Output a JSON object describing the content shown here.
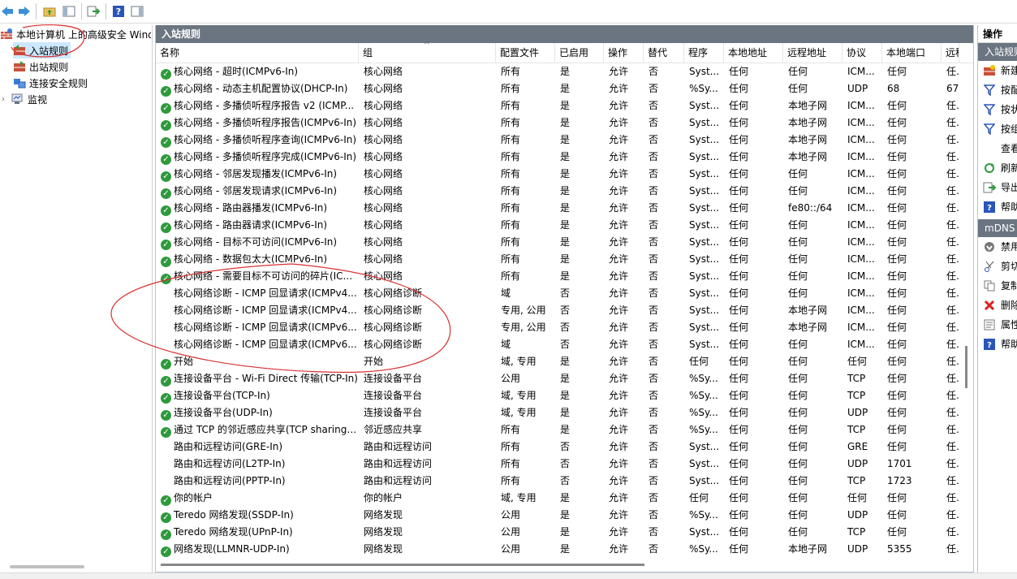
{
  "toolbar": {
    "icons": [
      "back-arrow-icon",
      "forward-arrow-icon",
      "folder-up-icon",
      "show-hide-console-tree-icon",
      "export-list-icon",
      "help-icon",
      "show-hide-action-pane-icon"
    ]
  },
  "tree": {
    "root": "本地计算机 上的高级安全 Windows Defender 防火墙",
    "items": [
      "入站规则",
      "出站规则",
      "连接安全规则",
      "监视"
    ]
  },
  "panel": {
    "title": "入站规则",
    "columns": [
      "名称",
      "组",
      "配置文件",
      "已启用",
      "操作",
      "替代",
      "程序",
      "本地地址",
      "远程地址",
      "协议",
      "本地端口",
      "远程"
    ],
    "rows": [
      {
        "enabled_icon": true,
        "name": "核心网络 - 超时(ICMPv6-In)",
        "group": "核心网络",
        "profile": "所有",
        "enabled": "是",
        "action": "允许",
        "override": "否",
        "program": "Syst...",
        "local_addr": "任何",
        "remote_addr": "任何",
        "protocol": "ICM...",
        "local_port": "任何",
        "remote": "任何"
      },
      {
        "enabled_icon": true,
        "name": "核心网络 - 动态主机配置协议(DHCP-In)",
        "group": "核心网络",
        "profile": "所有",
        "enabled": "是",
        "action": "允许",
        "override": "否",
        "program": "%Sy...",
        "local_addr": "任何",
        "remote_addr": "任何",
        "protocol": "UDP",
        "local_port": "68",
        "remote": "67"
      },
      {
        "enabled_icon": true,
        "name": "核心网络 - 多播侦听程序报告 v2 (ICMP...",
        "group": "核心网络",
        "profile": "所有",
        "enabled": "是",
        "action": "允许",
        "override": "否",
        "program": "Syst...",
        "local_addr": "任何",
        "remote_addr": "本地子网",
        "protocol": "ICM...",
        "local_port": "任何",
        "remote": "任何"
      },
      {
        "enabled_icon": true,
        "name": "核心网络 - 多播侦听程序报告(ICMPv6-In)",
        "group": "核心网络",
        "profile": "所有",
        "enabled": "是",
        "action": "允许",
        "override": "否",
        "program": "Syst...",
        "local_addr": "任何",
        "remote_addr": "本地子网",
        "protocol": "ICM...",
        "local_port": "任何",
        "remote": "任何"
      },
      {
        "enabled_icon": true,
        "name": "核心网络 - 多播侦听程序查询(ICMPv6-In)",
        "group": "核心网络",
        "profile": "所有",
        "enabled": "是",
        "action": "允许",
        "override": "否",
        "program": "Syst...",
        "local_addr": "任何",
        "remote_addr": "本地子网",
        "protocol": "ICM...",
        "local_port": "任何",
        "remote": "任何"
      },
      {
        "enabled_icon": true,
        "name": "核心网络 - 多播侦听程序完成(ICMPv6-In)",
        "group": "核心网络",
        "profile": "所有",
        "enabled": "是",
        "action": "允许",
        "override": "否",
        "program": "Syst...",
        "local_addr": "任何",
        "remote_addr": "本地子网",
        "protocol": "ICM...",
        "local_port": "任何",
        "remote": "任何"
      },
      {
        "enabled_icon": true,
        "name": "核心网络 - 邻居发现播发(ICMPv6-In)",
        "group": "核心网络",
        "profile": "所有",
        "enabled": "是",
        "action": "允许",
        "override": "否",
        "program": "Syst...",
        "local_addr": "任何",
        "remote_addr": "任何",
        "protocol": "ICM...",
        "local_port": "任何",
        "remote": "任何"
      },
      {
        "enabled_icon": true,
        "name": "核心网络 - 邻居发现请求(ICMPv6-In)",
        "group": "核心网络",
        "profile": "所有",
        "enabled": "是",
        "action": "允许",
        "override": "否",
        "program": "Syst...",
        "local_addr": "任何",
        "remote_addr": "任何",
        "protocol": "ICM...",
        "local_port": "任何",
        "remote": "任何"
      },
      {
        "enabled_icon": true,
        "name": "核心网络 - 路由器播发(ICMPv6-In)",
        "group": "核心网络",
        "profile": "所有",
        "enabled": "是",
        "action": "允许",
        "override": "否",
        "program": "Syst...",
        "local_addr": "任何",
        "remote_addr": "fe80::/64",
        "protocol": "ICM...",
        "local_port": "任何",
        "remote": "任何"
      },
      {
        "enabled_icon": true,
        "name": "核心网络 - 路由器请求(ICMPv6-In)",
        "group": "核心网络",
        "profile": "所有",
        "enabled": "是",
        "action": "允许",
        "override": "否",
        "program": "Syst...",
        "local_addr": "任何",
        "remote_addr": "任何",
        "protocol": "ICM...",
        "local_port": "任何",
        "remote": "任何"
      },
      {
        "enabled_icon": true,
        "name": "核心网络 - 目标不可访问(ICMPv6-In)",
        "group": "核心网络",
        "profile": "所有",
        "enabled": "是",
        "action": "允许",
        "override": "否",
        "program": "Syst...",
        "local_addr": "任何",
        "remote_addr": "任何",
        "protocol": "ICM...",
        "local_port": "任何",
        "remote": "任何"
      },
      {
        "enabled_icon": true,
        "name": "核心网络 - 数据包太大(ICMPv6-In)",
        "group": "核心网络",
        "profile": "所有",
        "enabled": "是",
        "action": "允许",
        "override": "否",
        "program": "Syst...",
        "local_addr": "任何",
        "remote_addr": "任何",
        "protocol": "ICM...",
        "local_port": "任何",
        "remote": "任何"
      },
      {
        "enabled_icon": true,
        "name": "核心网络 - 需要目标不可访问的碎片(IC...",
        "group": "核心网络",
        "profile": "所有",
        "enabled": "是",
        "action": "允许",
        "override": "否",
        "program": "Syst...",
        "local_addr": "任何",
        "remote_addr": "任何",
        "protocol": "ICM...",
        "local_port": "任何",
        "remote": "任何"
      },
      {
        "enabled_icon": false,
        "name": "核心网络诊断 - ICMP 回显请求(ICMPv4...",
        "group": "核心网络诊断",
        "profile": "域",
        "enabled": "否",
        "action": "允许",
        "override": "否",
        "program": "Syst...",
        "local_addr": "任何",
        "remote_addr": "任何",
        "protocol": "ICM...",
        "local_port": "任何",
        "remote": "任何"
      },
      {
        "enabled_icon": false,
        "name": "核心网络诊断 - ICMP 回显请求(ICMPv4...",
        "group": "核心网络诊断",
        "profile": "专用, 公用",
        "enabled": "否",
        "action": "允许",
        "override": "否",
        "program": "Syst...",
        "local_addr": "任何",
        "remote_addr": "本地子网",
        "protocol": "ICM...",
        "local_port": "任何",
        "remote": "任何"
      },
      {
        "enabled_icon": false,
        "name": "核心网络诊断 - ICMP 回显请求(ICMPv6...",
        "group": "核心网络诊断",
        "profile": "专用, 公用",
        "enabled": "否",
        "action": "允许",
        "override": "否",
        "program": "Syst...",
        "local_addr": "任何",
        "remote_addr": "本地子网",
        "protocol": "ICM...",
        "local_port": "任何",
        "remote": "任何"
      },
      {
        "enabled_icon": false,
        "name": "核心网络诊断 - ICMP 回显请求(ICMPv6...",
        "group": "核心网络诊断",
        "profile": "域",
        "enabled": "否",
        "action": "允许",
        "override": "否",
        "program": "Syst...",
        "local_addr": "任何",
        "remote_addr": "任何",
        "protocol": "ICM...",
        "local_port": "任何",
        "remote": "任何"
      },
      {
        "enabled_icon": true,
        "name": "开始",
        "group": "开始",
        "profile": "域, 专用",
        "enabled": "是",
        "action": "允许",
        "override": "否",
        "program": "任何",
        "local_addr": "任何",
        "remote_addr": "任何",
        "protocol": "任何",
        "local_port": "任何",
        "remote": "任何"
      },
      {
        "enabled_icon": true,
        "name": "连接设备平台 - Wi-Fi Direct 传输(TCP-In)",
        "group": "连接设备平台",
        "profile": "公用",
        "enabled": "是",
        "action": "允许",
        "override": "否",
        "program": "%Sy...",
        "local_addr": "任何",
        "remote_addr": "任何",
        "protocol": "TCP",
        "local_port": "任何",
        "remote": "任何"
      },
      {
        "enabled_icon": true,
        "name": "连接设备平台(TCP-In)",
        "group": "连接设备平台",
        "profile": "域, 专用",
        "enabled": "是",
        "action": "允许",
        "override": "否",
        "program": "%Sy...",
        "local_addr": "任何",
        "remote_addr": "任何",
        "protocol": "TCP",
        "local_port": "任何",
        "remote": "任何"
      },
      {
        "enabled_icon": true,
        "name": "连接设备平台(UDP-In)",
        "group": "连接设备平台",
        "profile": "域, 专用",
        "enabled": "是",
        "action": "允许",
        "override": "否",
        "program": "%Sy...",
        "local_addr": "任何",
        "remote_addr": "任何",
        "protocol": "UDP",
        "local_port": "任何",
        "remote": "任何"
      },
      {
        "enabled_icon": true,
        "name": "通过 TCP 的邻近感应共享(TCP sharing-...",
        "group": "邻近感应共享",
        "profile": "所有",
        "enabled": "是",
        "action": "允许",
        "override": "否",
        "program": "%Sy...",
        "local_addr": "任何",
        "remote_addr": "任何",
        "protocol": "TCP",
        "local_port": "任何",
        "remote": "任何"
      },
      {
        "enabled_icon": false,
        "name": "路由和远程访问(GRE-In)",
        "group": "路由和远程访问",
        "profile": "所有",
        "enabled": "否",
        "action": "允许",
        "override": "否",
        "program": "Syst...",
        "local_addr": "任何",
        "remote_addr": "任何",
        "protocol": "GRE",
        "local_port": "任何",
        "remote": "任何"
      },
      {
        "enabled_icon": false,
        "name": "路由和远程访问(L2TP-In)",
        "group": "路由和远程访问",
        "profile": "所有",
        "enabled": "否",
        "action": "允许",
        "override": "否",
        "program": "Syst...",
        "local_addr": "任何",
        "remote_addr": "任何",
        "protocol": "UDP",
        "local_port": "1701",
        "remote": "任何"
      },
      {
        "enabled_icon": false,
        "name": "路由和远程访问(PPTP-In)",
        "group": "路由和远程访问",
        "profile": "所有",
        "enabled": "否",
        "action": "允许",
        "override": "否",
        "program": "Syst...",
        "local_addr": "任何",
        "remote_addr": "任何",
        "protocol": "TCP",
        "local_port": "1723",
        "remote": "任何"
      },
      {
        "enabled_icon": true,
        "name": "你的帐户",
        "group": "你的帐户",
        "profile": "域, 专用",
        "enabled": "是",
        "action": "允许",
        "override": "否",
        "program": "任何",
        "local_addr": "任何",
        "remote_addr": "任何",
        "protocol": "任何",
        "local_port": "任何",
        "remote": "任何"
      },
      {
        "enabled_icon": true,
        "name": "Teredo 网络发现(SSDP-In)",
        "group": "网络发现",
        "profile": "公用",
        "enabled": "是",
        "action": "允许",
        "override": "否",
        "program": "%Sy...",
        "local_addr": "任何",
        "remote_addr": "任何",
        "protocol": "UDP",
        "local_port": "任何",
        "remote": "任何"
      },
      {
        "enabled_icon": true,
        "name": "Teredo 网络发现(UPnP-In)",
        "group": "网络发现",
        "profile": "公用",
        "enabled": "是",
        "action": "允许",
        "override": "否",
        "program": "Syst...",
        "local_addr": "任何",
        "remote_addr": "任何",
        "protocol": "TCP",
        "local_port": "任何",
        "remote": "任何"
      },
      {
        "enabled_icon": true,
        "name": "网络发现(LLMNR-UDP-In)",
        "group": "网络发现",
        "profile": "公用",
        "enabled": "是",
        "action": "允许",
        "override": "否",
        "program": "%Sy...",
        "local_addr": "任何",
        "remote_addr": "本地子网",
        "protocol": "UDP",
        "local_port": "5355",
        "remote": "任何"
      }
    ]
  },
  "actions": {
    "title": "操作",
    "section1": "入站规则",
    "items1": [
      {
        "label": "新建规则...",
        "icon": "new-rule-icon"
      },
      {
        "label": "按配置文件筛选",
        "icon": "filter-icon"
      },
      {
        "label": "按状态筛选",
        "icon": "filter-icon"
      },
      {
        "label": "按组筛选",
        "icon": "filter-icon"
      },
      {
        "label": "查看",
        "icon": "view-icon"
      },
      {
        "label": "刷新",
        "icon": "refresh-icon"
      },
      {
        "label": "导出列表...",
        "icon": "export-icon"
      },
      {
        "label": "帮助",
        "icon": "help-icon"
      }
    ],
    "section2": "mDNS",
    "items2": [
      {
        "label": "禁用规则",
        "icon": "disable-icon"
      },
      {
        "label": "剪切",
        "icon": "cut-icon"
      },
      {
        "label": "复制",
        "icon": "copy-icon"
      },
      {
        "label": "删除",
        "icon": "delete-icon"
      },
      {
        "label": "属性",
        "icon": "properties-icon"
      },
      {
        "label": "帮助",
        "icon": "help-icon"
      }
    ]
  },
  "colors": {
    "titlebar": "#6b7582",
    "check": "#2e9a3c",
    "annotation": "#d83030"
  }
}
